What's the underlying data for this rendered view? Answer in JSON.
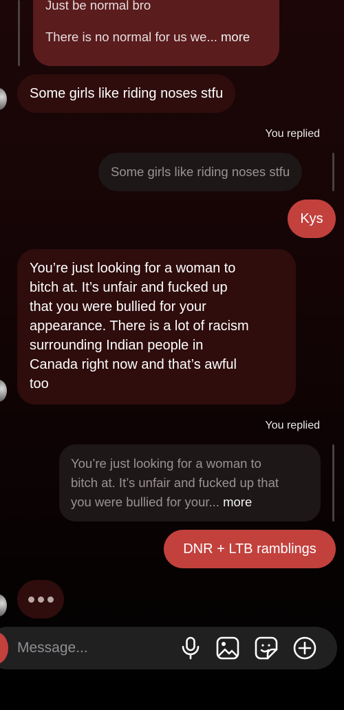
{
  "thread": {
    "top_quote": {
      "partial_line": "Just be normal bro",
      "text": "There is no normal for us we...",
      "more": "more"
    },
    "messages": [
      {
        "text": "Some girls like riding noses stfu"
      },
      {
        "reply_label": "You replied",
        "quoted": "Some girls like riding noses stfu",
        "text": "Kys"
      },
      {
        "text": "You’re just looking for a woman to bitch at. It’s unfair and fucked up that you were bullied for your appearance. There is a lot of racism surrounding Indian people in Canada right now and that’s awful too",
        "lines": [
          "You’re just looking for a woman to",
          "bitch at. It’s unfair and fucked up",
          "that you were bullied for your",
          "appearance. There is a lot of racism",
          "surrounding Indian people in",
          "Canada right now and that’s awful",
          "too"
        ]
      },
      {
        "reply_label": "You replied",
        "quoted_lines": [
          "You’re just looking for a woman to",
          "bitch at. It’s unfair and fucked up that",
          "you were bullied for your..."
        ],
        "more": "more",
        "text": "DNR + LTB ramblings"
      }
    ],
    "typing_indicator": true
  },
  "composer": {
    "placeholder": "Message...",
    "icons": [
      "camera-icon",
      "microphone-icon",
      "gallery-icon",
      "sticker-icon",
      "plus-circle-icon"
    ]
  },
  "colors": {
    "sent_bubble": "#c2413d",
    "received_bubble": "#2e0d0c",
    "reply_quote": "#1d1717"
  }
}
